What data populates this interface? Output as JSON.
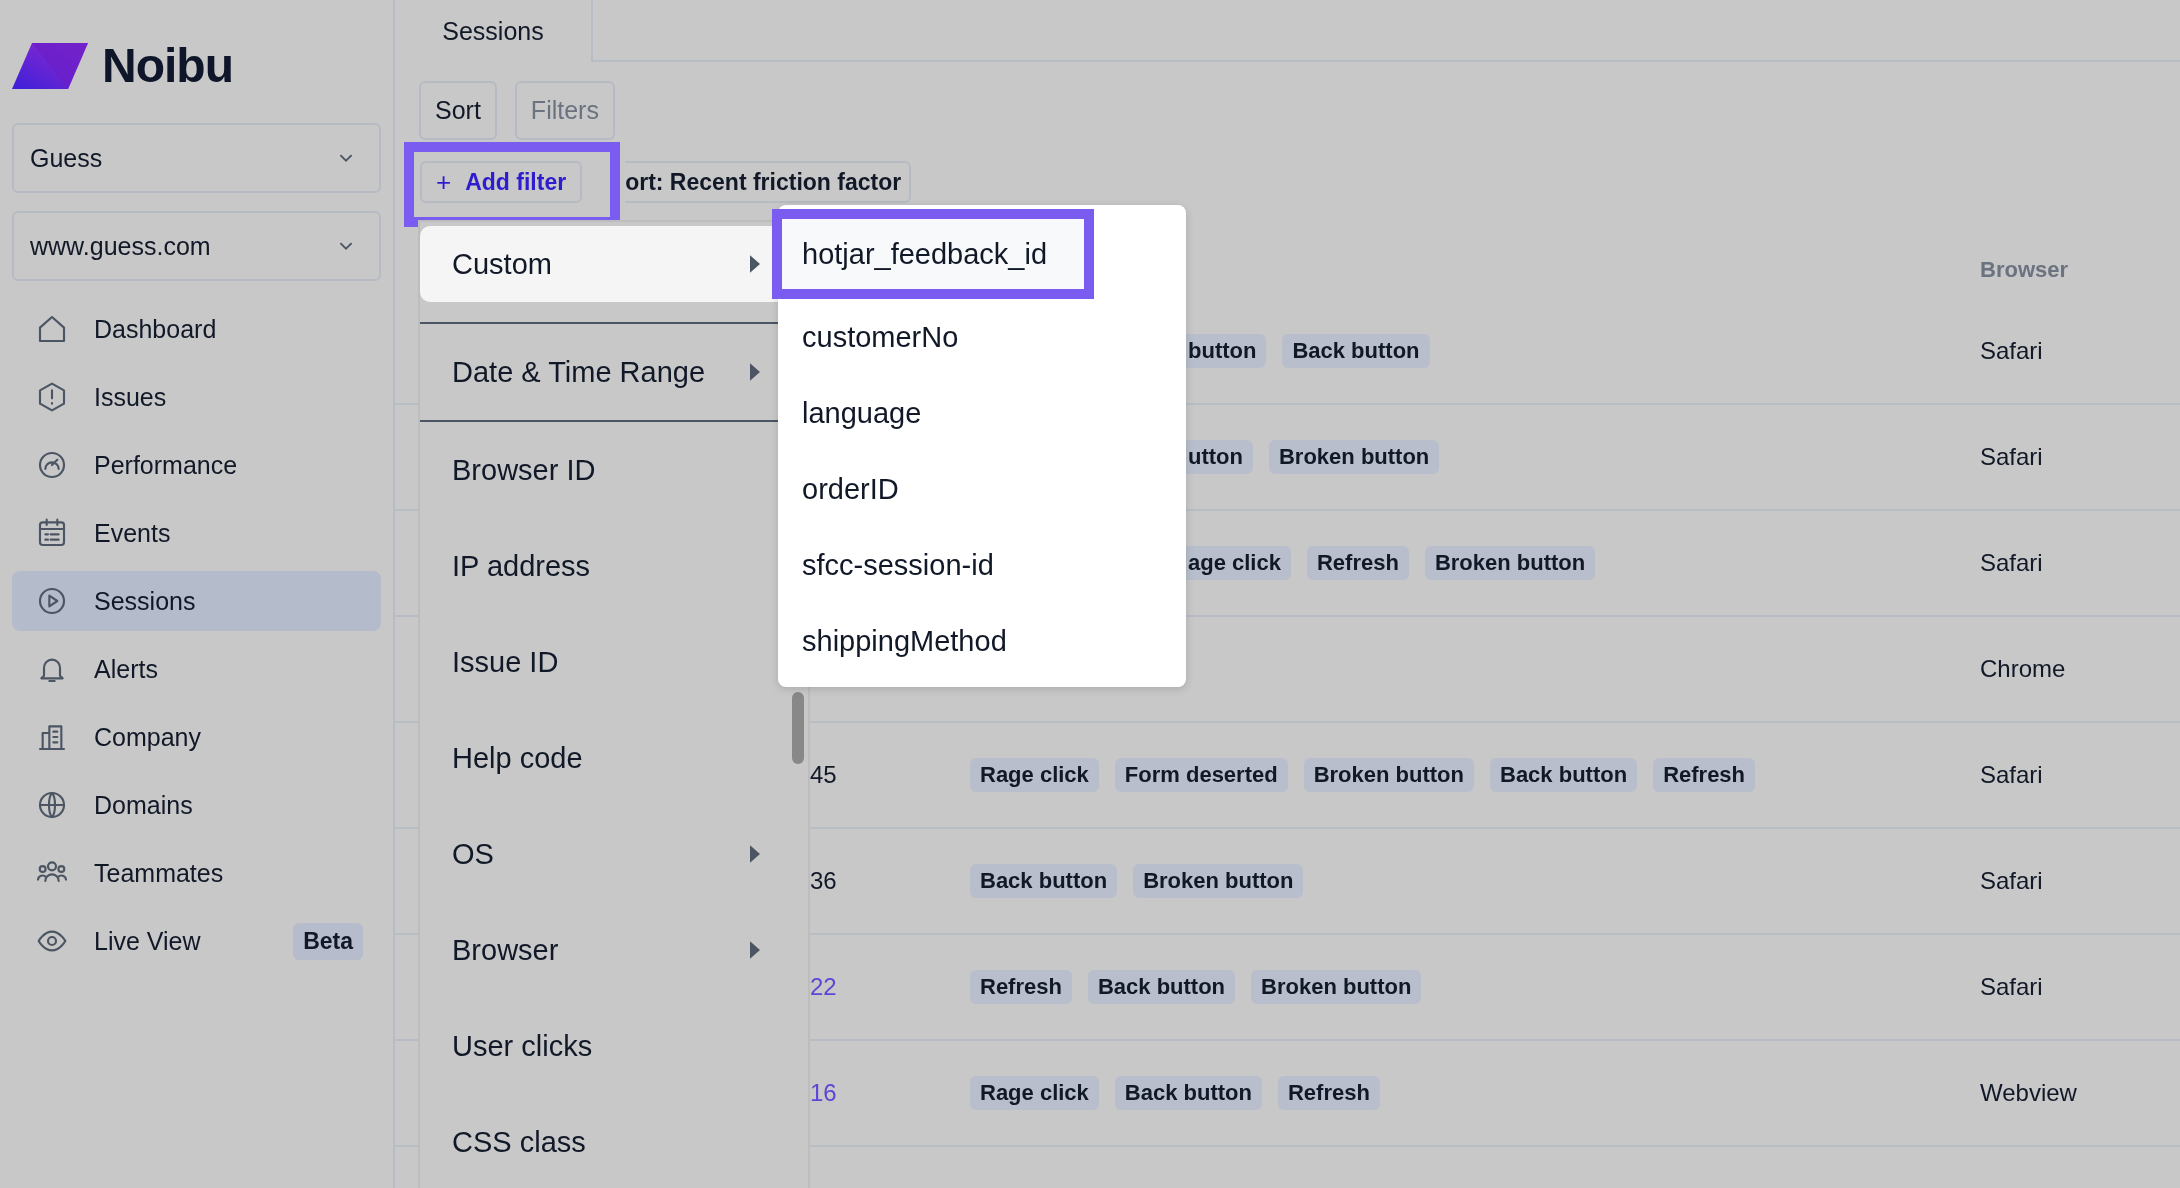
{
  "sidebar": {
    "logo": "Noibu",
    "selects": [
      {
        "value": "Guess"
      },
      {
        "value": "www.guess.com"
      }
    ],
    "nav": [
      {
        "label": "Dashboard",
        "selected": false
      },
      {
        "label": "Issues",
        "selected": false
      },
      {
        "label": "Performance",
        "selected": false
      },
      {
        "label": "Events",
        "selected": false
      },
      {
        "label": "Sessions",
        "selected": true
      },
      {
        "label": "Alerts",
        "selected": false
      },
      {
        "label": "Company",
        "selected": false
      },
      {
        "label": "Domains",
        "selected": false
      },
      {
        "label": "Teammates",
        "selected": false
      },
      {
        "label": "Live View",
        "selected": false,
        "badge": "Beta"
      }
    ]
  },
  "tabs": [
    {
      "label": "Sessions",
      "selected": true
    }
  ],
  "toolbar": [
    {
      "label": "Sort",
      "selected": true
    },
    {
      "label": "Filters",
      "selected": false
    }
  ],
  "filter_bar": {
    "add_icon": "+",
    "add_filter": "Add filter",
    "highlighted": true,
    "sort_chip": "ort: Recent friction factor"
  },
  "filter_menu": [
    {
      "label": "Custom",
      "kind": "submenu",
      "selected": true,
      "divider_after": true
    },
    {
      "label": "Date & Time Range",
      "kind": "submenu",
      "selected": false,
      "divider_after": true
    },
    {
      "label": "Browser ID",
      "kind": "plain",
      "selected": false,
      "divider_after": false
    },
    {
      "label": "IP address",
      "kind": "plain",
      "selected": false,
      "divider_after": false
    },
    {
      "label": "Issue ID",
      "kind": "plain",
      "selected": false,
      "divider_after": false
    },
    {
      "label": "Help code",
      "kind": "plain",
      "selected": false,
      "divider_after": false
    },
    {
      "label": "OS",
      "kind": "submenu",
      "selected": false,
      "divider_after": false
    },
    {
      "label": "Browser",
      "kind": "submenu",
      "selected": false,
      "divider_after": false
    },
    {
      "label": "User clicks",
      "kind": "plain",
      "selected": false,
      "divider_after": false
    },
    {
      "label": "CSS class",
      "kind": "plain",
      "selected": false,
      "divider_after": false
    }
  ],
  "custom_submenu": [
    {
      "label": "hotjar_feedback_id",
      "selected": true
    },
    {
      "label": "customerNo",
      "selected": false
    },
    {
      "label": "language",
      "selected": false
    },
    {
      "label": "orderID",
      "selected": false
    },
    {
      "label": "sfcc-session-id",
      "selected": false
    },
    {
      "label": "shippingMethod",
      "selected": false
    }
  ],
  "table": {
    "columns": [
      {
        "label": "Browser"
      }
    ],
    "rows": [
      {
        "tags": [
          {
            "label": "button",
            "cut": true
          },
          {
            "label": "Back button",
            "cut": false
          }
        ],
        "browser": "Safari"
      },
      {
        "tags": [
          {
            "label": "utton",
            "cut": true
          },
          {
            "label": "Broken button",
            "cut": false
          }
        ],
        "browser": "Safari"
      },
      {
        "tags": [
          {
            "label": "age click",
            "cut": true
          },
          {
            "label": "Refresh",
            "cut": false
          },
          {
            "label": "Broken button",
            "cut": false
          }
        ],
        "browser": "Safari"
      },
      {
        "tags": [],
        "browser": "Chrome"
      },
      {
        "score": "45",
        "link": false,
        "tags": [
          {
            "label": "Rage click",
            "cut": false
          },
          {
            "label": "Form deserted",
            "cut": false
          },
          {
            "label": "Broken button",
            "cut": false
          },
          {
            "label": "Back button",
            "cut": false
          },
          {
            "label": "Refresh",
            "cut": false
          }
        ],
        "browser": "Safari"
      },
      {
        "score": "36",
        "link": false,
        "tags": [
          {
            "label": "Back button",
            "cut": false
          },
          {
            "label": "Broken button",
            "cut": false
          }
        ],
        "browser": "Safari"
      },
      {
        "score": "22",
        "link": true,
        "tags": [
          {
            "label": "Refresh",
            "cut": false
          },
          {
            "label": "Back button",
            "cut": false
          },
          {
            "label": "Broken button",
            "cut": false
          }
        ],
        "browser": "Safari"
      },
      {
        "score": "16",
        "link": true,
        "tags": [
          {
            "label": "Rage click",
            "cut": false
          },
          {
            "label": "Back button",
            "cut": false
          },
          {
            "label": "Refresh",
            "cut": false
          }
        ],
        "browser": "Webview"
      }
    ]
  }
}
